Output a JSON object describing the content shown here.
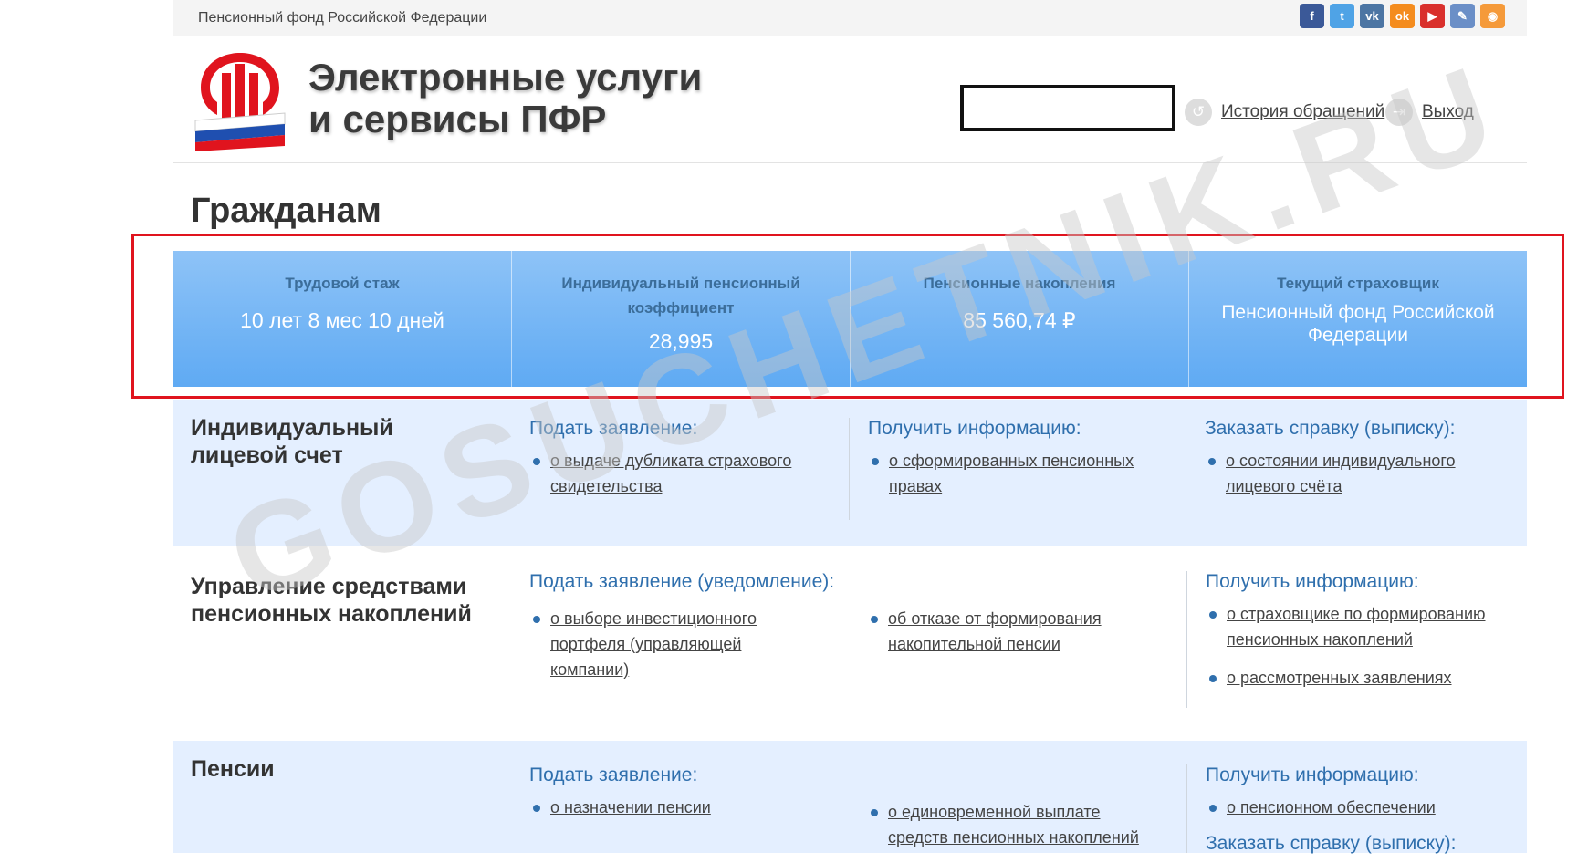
{
  "topbar": {
    "org_name": "Пенсионный фонд Российской Федерации",
    "social": [
      {
        "icon": "facebook-icon",
        "glyph": "f",
        "color": "#3b5998"
      },
      {
        "icon": "twitter-icon",
        "glyph": "t",
        "color": "#4fa3e6"
      },
      {
        "icon": "vk-icon",
        "glyph": "vk",
        "color": "#4c75a3"
      },
      {
        "icon": "odnoklassniki-icon",
        "glyph": "ok",
        "color": "#f48c1e"
      },
      {
        "icon": "youtube-icon",
        "glyph": "▶",
        "color": "#d9302c"
      },
      {
        "icon": "livejournal-icon",
        "glyph": "✎",
        "color": "#6b8fc7"
      },
      {
        "icon": "rss-icon",
        "glyph": "◉",
        "color": "#f59a3a"
      }
    ]
  },
  "header": {
    "title_line1": "Электронные услуги",
    "title_line2": "и сервисы ПФР",
    "history_link": "История обращений",
    "logout_link": "Выход"
  },
  "page_title": "Гражданам",
  "stats": [
    {
      "label": "Трудовой стаж",
      "value": "10 лет 8 мес 10 дней"
    },
    {
      "label": "Индивидуальный пенсионный коэффициент",
      "value": "28,995"
    },
    {
      "label": "Пенсионные накопления",
      "value": "85 560,74  ₽"
    },
    {
      "label": "Текущий страховщик",
      "value": "Пенсионный фонд Российской Федерации"
    }
  ],
  "sections": {
    "account": {
      "title": "Индивидуальный лицевой счет",
      "apply_head": "Подать заявление:",
      "apply_items": [
        "о выдаче дубликата страхового свидетельства"
      ],
      "info_head": "Получить информацию:",
      "info_items": [
        "о сформированных пенсионных правах"
      ],
      "order_head": "Заказать справку (выписку):",
      "order_items": [
        "о состоянии индивидуального лицевого счёта"
      ]
    },
    "savings": {
      "title": "Управление средствами пенсионных накоплений",
      "apply_head": "Подать заявление (уведомление):",
      "apply_items": [
        "о выборе инвестиционного портфеля (управляющей компании)"
      ],
      "apply_items2": [
        "об отказе от формирования накопительной пенсии"
      ],
      "info_head": "Получить информацию:",
      "info_items": [
        "о страховщике по формированию пенсионных накоплений",
        "о рассмотренных заявлениях"
      ]
    },
    "pensions": {
      "title": "Пенсии",
      "apply_head": "Подать заявление:",
      "apply_items": [
        "о назначении пенсии"
      ],
      "apply_items2": [
        "о единовременной выплате средств пенсионных накоплений"
      ],
      "info_head": "Получить информацию:",
      "info_items": [
        "о пенсионном обеспечении"
      ],
      "order_head": "Заказать справку (выписку):"
    }
  },
  "watermark": "GOSUCHETNIK.RU"
}
